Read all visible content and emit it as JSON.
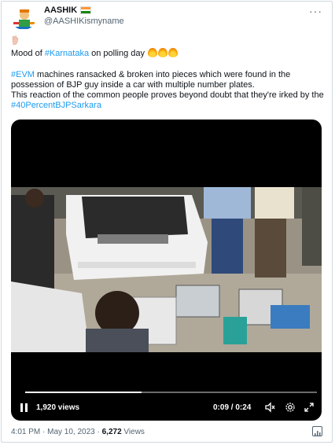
{
  "author": {
    "display_name": "AASHIK",
    "handle": "@AASHIKismyname",
    "avatar_icon": "cartoon-logo",
    "flag_icon": "india-flag"
  },
  "tweet": {
    "line1_prefix": "Mood of ",
    "line1_hashtag": "#Karnataka",
    "line1_suffix": " on polling day",
    "para_hashtag": "#EVM",
    "para_text": " machines ransacked & broken into pieces which were found in the possession of BJP guy inside a car with multiple number plates.",
    "para2_text": "This reaction of the common people proves beyond doubt that they're irked by the ",
    "para2_hashtag": "#40PercentBJPSarkara",
    "link_color": "#1d9bf0"
  },
  "video": {
    "views": "1,920 views",
    "time": "0:09 / 0:24",
    "progress": 0.4
  },
  "footer": {
    "time_date": "4:01 PM · May 10, 2023 · ",
    "views_count": "6,272",
    "views_label": " Views"
  },
  "more_icon": "more-dots-icon"
}
